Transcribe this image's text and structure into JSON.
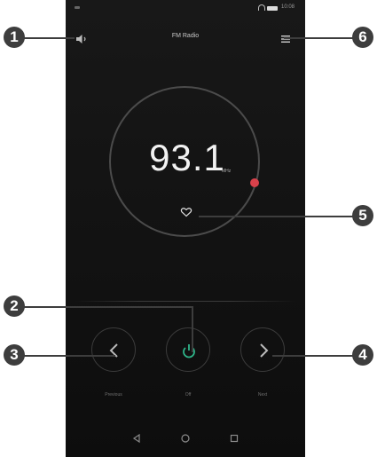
{
  "status_bar": {
    "time": "10:08"
  },
  "app": {
    "title": "FM Radio"
  },
  "station": {
    "frequency": "93.1",
    "unit": "MHz"
  },
  "controls": {
    "previous_label": "Previous",
    "power_label": "Off",
    "next_label": "Next"
  },
  "callouts": [
    "1",
    "2",
    "3",
    "4",
    "5",
    "6"
  ],
  "colors": {
    "power_accent": "#2fb58a",
    "tuning_marker": "#d9414b",
    "callout": "#3d3d3d"
  },
  "icons": [
    "speaker-icon",
    "menu-icon",
    "favorite-heart-icon",
    "chevron-left-icon",
    "power-icon",
    "chevron-right-icon",
    "nav-back-icon",
    "nav-home-icon",
    "nav-recent-icon"
  ]
}
